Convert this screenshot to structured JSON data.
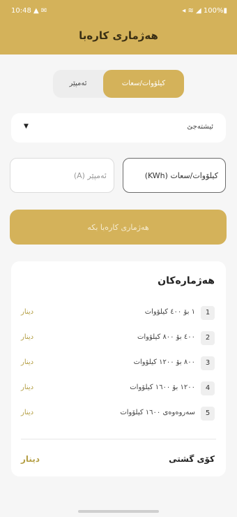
{
  "status_bar": {
    "time": "10:48",
    "icons_left": "▲ ✉",
    "icons_right": "◂ ≋ ◢ 100%▮"
  },
  "app_title": "هەژماری کارەبا",
  "mode_toggle": {
    "active_label": "کیلۆوات/سعات",
    "inactive_label": "ئەمپێر"
  },
  "dropdown": {
    "value": "ئیشتەجێ"
  },
  "inputs": {
    "kwh_placeholder": "کیلۆوات/سعات (KWh)",
    "amp_placeholder": "ئەمپێر (A)"
  },
  "calculate_label": "هەژماری کارەبا بکە",
  "results": {
    "title": "هەژمارەکان",
    "tiers": [
      {
        "num": "1",
        "range": "١ بۆ ٤٠٠ کیلۆوات",
        "currency": "دینار"
      },
      {
        "num": "2",
        "range": "٤٠٠ بۆ ٨٠٠ کیلۆوات",
        "currency": "دینار"
      },
      {
        "num": "3",
        "range": "٨٠٠ بۆ ١٢٠٠ کیلۆوات",
        "currency": "دینار"
      },
      {
        "num": "4",
        "range": "١٢٠٠ بۆ ١٦٠٠ کیلۆوات",
        "currency": "دینار"
      },
      {
        "num": "5",
        "range": "سەروەوەی ١٦٠٠ کیلۆوات",
        "currency": "دینار"
      }
    ],
    "total_label": "کۆی گشتی",
    "total_currency": "دینار"
  },
  "colors": {
    "accent": "#d4b25a",
    "currency": "#b5a048",
    "background": "#f6f6f6"
  }
}
